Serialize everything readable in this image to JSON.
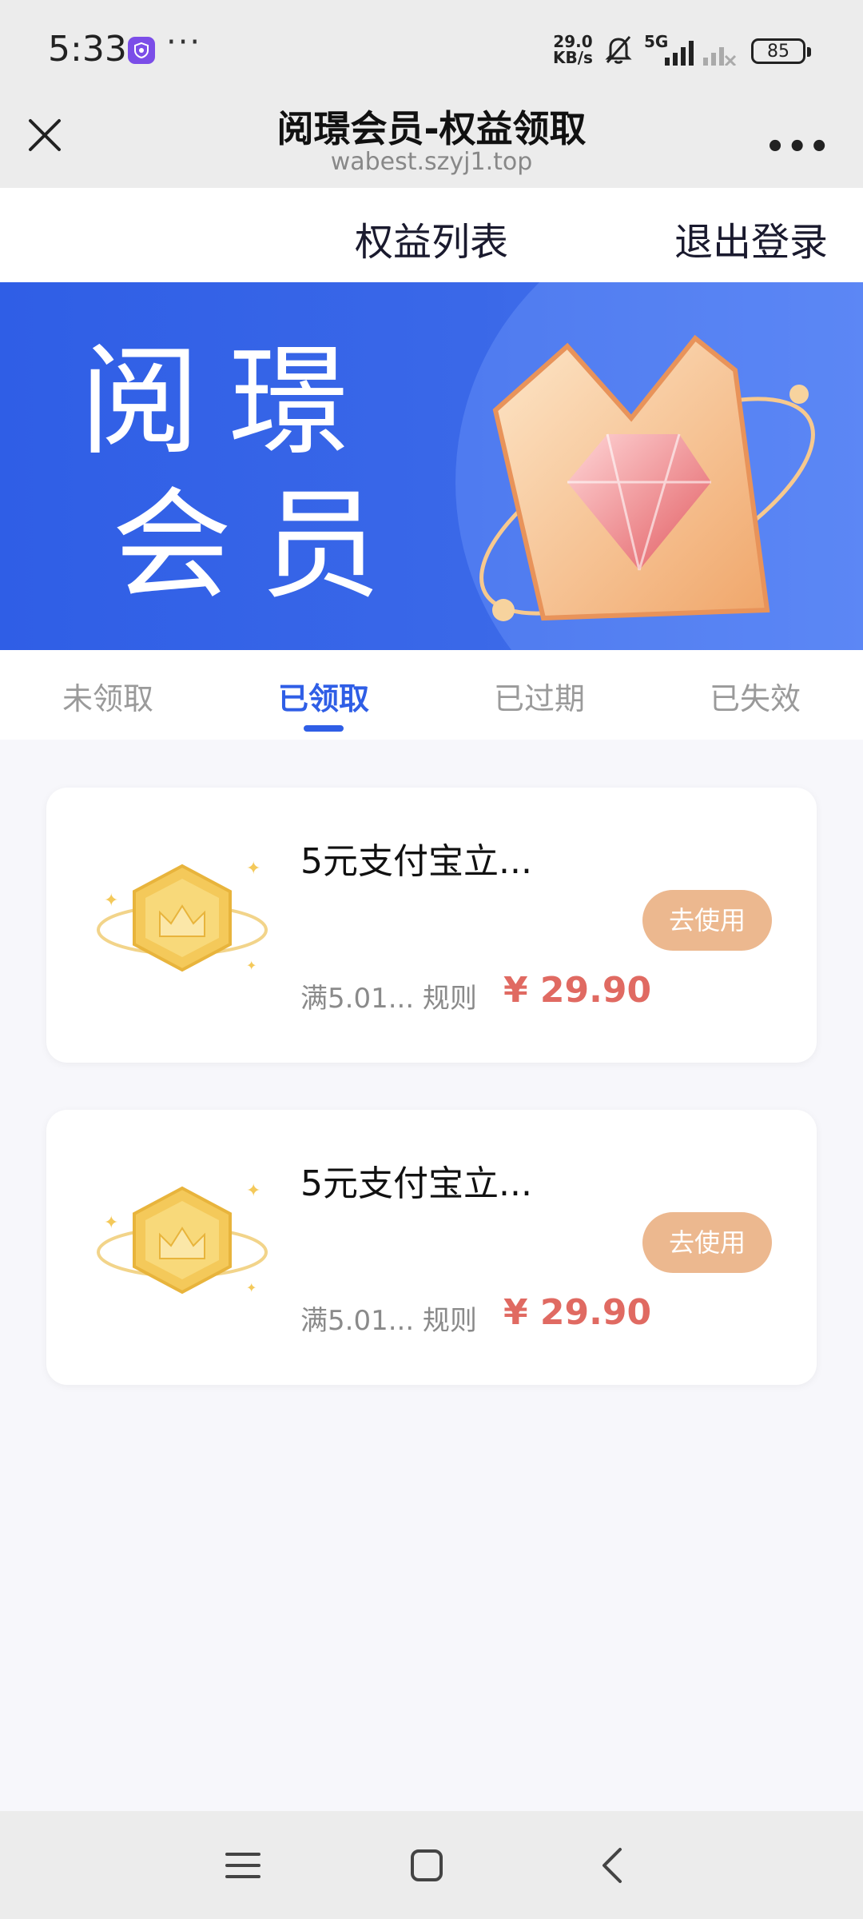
{
  "status_bar": {
    "time": "5:33",
    "more": "···",
    "speed_value": "29.0",
    "speed_unit": "KB/s",
    "network": "5G",
    "battery": "85"
  },
  "title_bar": {
    "title": "阅璟会员-权益领取",
    "url": "wabest.szyj1.top",
    "menu": "•••"
  },
  "top_nav": {
    "benefits_list": "权益列表",
    "logout": "退出登录"
  },
  "banner": {
    "line1": "阅璟",
    "line2": "会员"
  },
  "tabs": [
    {
      "label": "未领取",
      "active": false
    },
    {
      "label": "已领取",
      "active": true
    },
    {
      "label": "已过期",
      "active": false
    },
    {
      "label": "已失效",
      "active": false
    }
  ],
  "coupons": [
    {
      "name": "5元支付宝立...",
      "rule": "满5.01... 规则",
      "price": "¥ 29.90",
      "action": "去使用"
    },
    {
      "name": "5元支付宝立...",
      "rule": "满5.01... 规则",
      "price": "¥ 29.90",
      "action": "去使用"
    }
  ],
  "colors": {
    "accent": "#2f5ee6",
    "price": "#e06a62",
    "use_button": "#ecb88f"
  }
}
